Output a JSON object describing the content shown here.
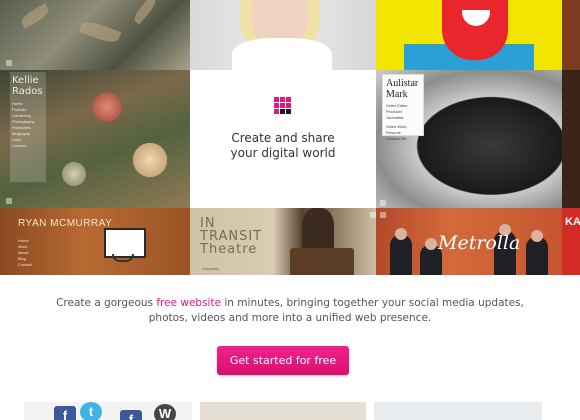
{
  "mosaic": {
    "kellie": {
      "name": "Kellie Rados",
      "menu": [
        "Home",
        "Portfolio",
        "Gardening",
        "Photography",
        "Favourites",
        "Biography",
        "Links",
        "Contact"
      ]
    },
    "aulistar": {
      "name": "Aulistar Mark",
      "roles": [
        "Video Editor",
        "Producer",
        "Journalist"
      ],
      "menu": [
        "Video Work",
        "Resume",
        "Contact Me"
      ]
    },
    "ryan": {
      "name": "RYAN MCMURRAY",
      "menu": [
        "Home",
        "Work",
        "About",
        "Blog",
        "Contact"
      ]
    },
    "transit": {
      "title_line1": "IN",
      "title_line2": "TRANSIT",
      "title_line3": "Theatre",
      "subtitle": "Company"
    },
    "metrolla": {
      "title": "Metrolla"
    },
    "edge_text": "KA"
  },
  "center": {
    "tagline_line1": "Create and share",
    "tagline_line2": "your digital world"
  },
  "intro": {
    "text_before": "Create a gorgeous ",
    "link": "free website",
    "text_after": " in minutes, bringing together your social media updates, photos, videos and more into a unified web presence."
  },
  "cta": {
    "label": "Get started for free"
  },
  "icons": {
    "logo": "grid-logo-icon",
    "facebook": "facebook-icon",
    "twitter": "twitter-icon",
    "wordpress": "wordpress-icon"
  },
  "colors": {
    "accent": "#e3157f",
    "cta": "#e8197f",
    "text": "#555555"
  }
}
